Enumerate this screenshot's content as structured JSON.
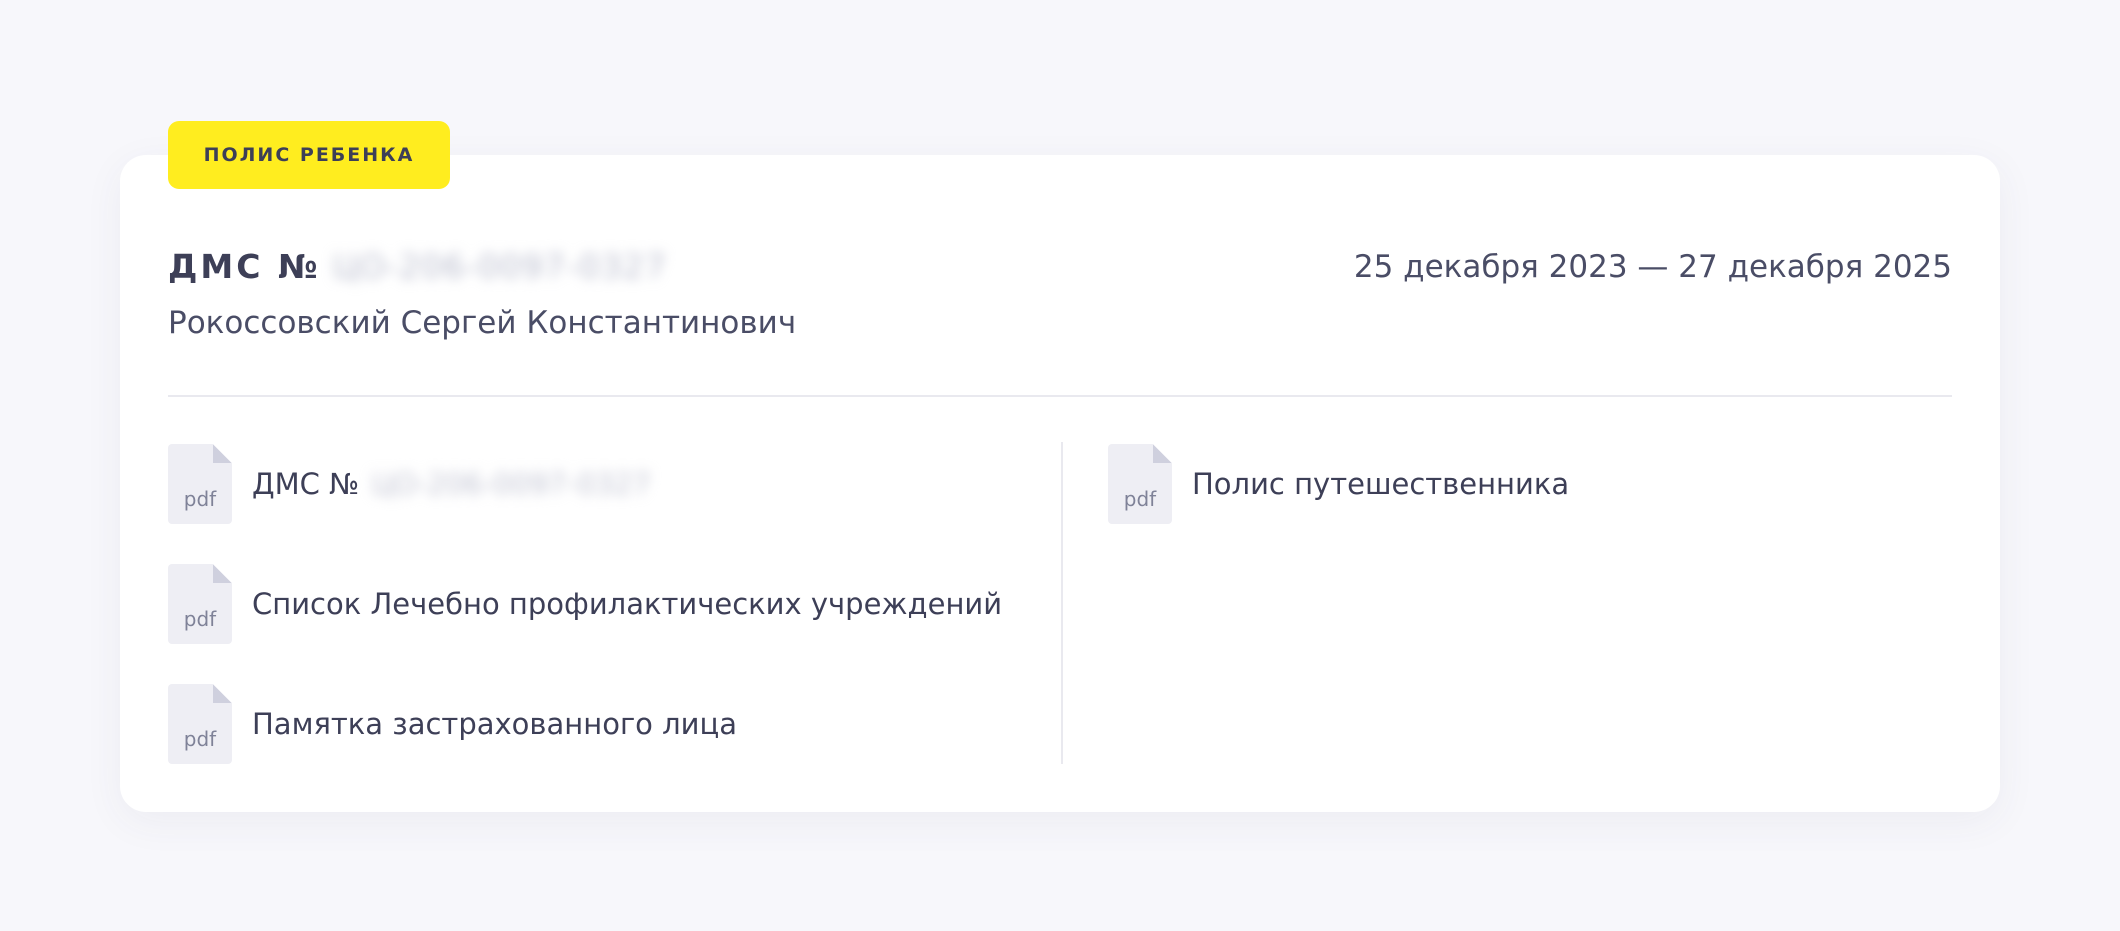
{
  "badge": {
    "label": "ПОЛИС РЕБЕНКА"
  },
  "policy": {
    "title_prefix": "ДМС №",
    "number": "ЦО-206-0097-0327",
    "holder": "Рокоссовский Сергей Константинович",
    "period": "25 декабря 2023 — 27 декабря 2025"
  },
  "documents": {
    "left": [
      {
        "ext": "pdf",
        "label": "ДМС №",
        "number": "ЦО-206-0097-0327"
      },
      {
        "ext": "pdf",
        "label": "Список Лечебно профилактических учреждений"
      },
      {
        "ext": "pdf",
        "label": "Памятка застрахованного лица"
      }
    ],
    "right": [
      {
        "ext": "pdf",
        "label": "Полис путешественника"
      }
    ]
  },
  "icons": {
    "file": "pdf-file-icon"
  }
}
